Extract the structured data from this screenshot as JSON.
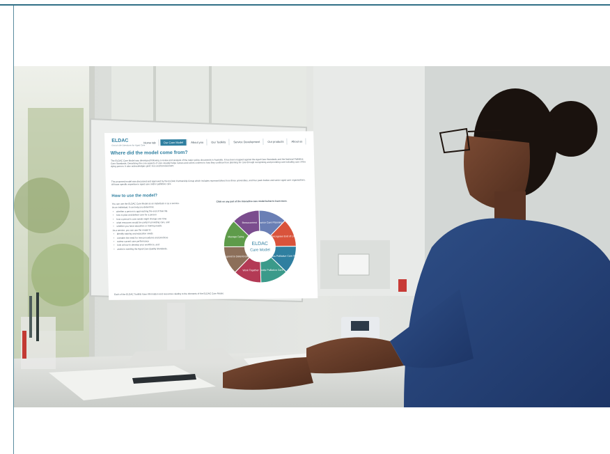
{
  "screen": {
    "logo": "ELDAC",
    "logo_sub": "End of Life Directions for Aged Care",
    "nav": [
      "Home tab",
      "Our Care Model",
      "About you",
      "Our Toolkits",
      "Service Development",
      "Our products",
      "About us"
    ],
    "heading_main": "Where did the model come from?",
    "para1": "The ELDAC Care Model was developed following a review and analysis of the major policy documents in Australia. It has been mapped against the Aged Care Standards and the National Palliative Care Standards. Describing the core aspects of care visually helps nurses and carers connect to how they continue from planning for care through recognising and providing care including care of the dying person. It also acknowledges grief, loss and bereavement.",
    "para2": "The proposed model was discussed and approved by the ELDAC Partnership Group which includes representatives from three universities, and four peak bodies and senior aged care organisations. All have specific expertise in aged care and/or palliative care.",
    "heading_how": "How to use the model?",
    "intro1": "You can use the ELDAC Care Model as an individual or as a service.",
    "intro2": "As an individual, it can help you determine:",
    "individual_items": [
      "whether a person is approaching the end of their life",
      "how to plan and deliver care for a person",
      "how a person's care needs might change over time",
      "what resources would be useful in providing care, and",
      "whether you have education or training needs."
    ],
    "intro3": "As a service, you can use the model to:",
    "service_items": [
      "identify training and education needs",
      "consider the need for new procedures and practices",
      "review current care performance",
      "look at how to develop your workforce, and",
      "assist in meeting the Aged Care Quality Standards."
    ],
    "click_note": "Click on any part of the interactive care model below to learn more.",
    "wheel_center_top": "ELDAC",
    "wheel_center_bottom": "Care Model",
    "wheel_segments": [
      {
        "label": "Advance Care Planning",
        "color": "#6a7fb5"
      },
      {
        "label": "Recognise End of Life",
        "color": "#d9533b"
      },
      {
        "label": "Assess Palliative Care Needs",
        "color": "#2f7fa0"
      },
      {
        "label": "Provide Palliative Care",
        "color": "#3b9a8a"
      },
      {
        "label": "Work Together",
        "color": "#b33a55"
      },
      {
        "label": "Respond to Deterioration",
        "color": "#8c6f5a"
      },
      {
        "label": "Manage Dying",
        "color": "#5e9b4a"
      },
      {
        "label": "Bereavement",
        "color": "#7b4d8e"
      }
    ],
    "footer_note": "Each of the ELDAC Toolkits have information and resources relating to the elements of the ELDAC Care Model."
  }
}
